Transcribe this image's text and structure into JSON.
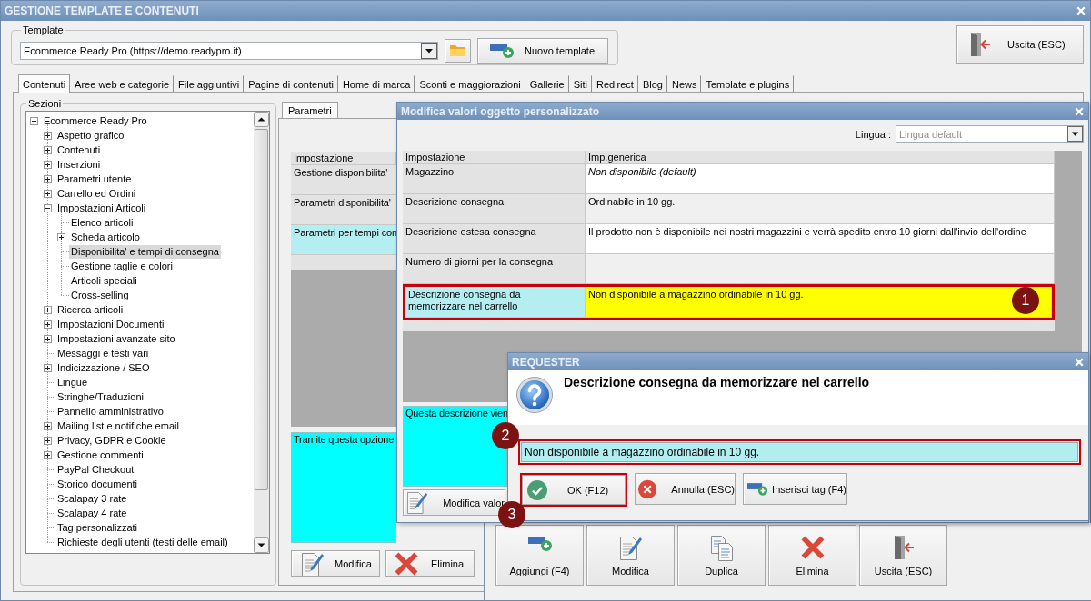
{
  "window": {
    "title": "GESTIONE TEMPLATE E CONTENUTI"
  },
  "template": {
    "legend": "Template",
    "value": "Ecommerce Ready Pro (https://demo.readypro.it)",
    "new_button": "Nuovo template"
  },
  "exit_button": "Uscita (ESC)",
  "tabs": [
    {
      "label": "Contenuti",
      "selected": true
    },
    {
      "label": "Aree web e categorie",
      "selected": false
    },
    {
      "label": "File aggiuntivi",
      "selected": false
    },
    {
      "label": "Pagine di contenuti",
      "selected": false
    },
    {
      "label": "Home di marca",
      "selected": false
    },
    {
      "label": "Sconti e maggiorazioni",
      "selected": false
    },
    {
      "label": "Gallerie",
      "selected": false
    },
    {
      "label": "Siti",
      "selected": false
    },
    {
      "label": "Redirect",
      "selected": false
    },
    {
      "label": "Blog",
      "selected": false
    },
    {
      "label": "News",
      "selected": false
    },
    {
      "label": "Template e plugins",
      "selected": false
    }
  ],
  "sections": {
    "legend": "Sezioni",
    "tree": [
      {
        "label": "Ecommerce Ready Pro",
        "kind": "group",
        "expanded": true,
        "selected": false,
        "children": [
          {
            "label": "Aspetto grafico",
            "kind": "group",
            "expanded": false,
            "selected": false
          },
          {
            "label": "Contenuti",
            "kind": "group",
            "expanded": false,
            "selected": false
          },
          {
            "label": "Inserzioni",
            "kind": "group",
            "expanded": false,
            "selected": false
          },
          {
            "label": "Parametri utente",
            "kind": "group",
            "expanded": false,
            "selected": false
          },
          {
            "label": "Carrello ed Ordini",
            "kind": "group",
            "expanded": false,
            "selected": false
          },
          {
            "label": "Impostazioni Articoli",
            "kind": "group",
            "expanded": true,
            "selected": false,
            "children": [
              {
                "label": "Elenco articoli",
                "kind": "leaf",
                "selected": false
              },
              {
                "label": "Scheda articolo",
                "kind": "group",
                "expanded": false,
                "selected": false
              },
              {
                "label": "Disponibilita' e tempi di consegna",
                "kind": "leaf",
                "selected": true
              },
              {
                "label": "Gestione taglie e colori",
                "kind": "leaf",
                "selected": false
              },
              {
                "label": "Articoli speciali",
                "kind": "leaf",
                "selected": false
              },
              {
                "label": "Cross-selling",
                "kind": "leaf",
                "selected": false
              }
            ]
          },
          {
            "label": "Ricerca articoli",
            "kind": "group",
            "expanded": false,
            "selected": false
          },
          {
            "label": "Impostazioni Documenti",
            "kind": "group",
            "expanded": false,
            "selected": false
          },
          {
            "label": "Impostazioni avanzate sito",
            "kind": "group",
            "expanded": false,
            "selected": false
          },
          {
            "label": "Messaggi e testi vari",
            "kind": "leaf",
            "selected": false
          },
          {
            "label": "Indicizzazione / SEO",
            "kind": "group",
            "expanded": false,
            "selected": false
          },
          {
            "label": "Lingue",
            "kind": "leaf",
            "selected": false
          },
          {
            "label": "Stringhe/Traduzioni",
            "kind": "leaf",
            "selected": false
          },
          {
            "label": "Pannello amministrativo",
            "kind": "leaf",
            "selected": false
          },
          {
            "label": "Mailing list e notifiche email",
            "kind": "group",
            "expanded": false,
            "selected": false
          },
          {
            "label": "Privacy, GDPR e Cookie",
            "kind": "group",
            "expanded": false,
            "selected": false
          },
          {
            "label": "Gestione commenti",
            "kind": "group",
            "expanded": false,
            "selected": false
          },
          {
            "label": "PayPal Checkout",
            "kind": "leaf",
            "selected": false
          },
          {
            "label": "Storico documenti",
            "kind": "leaf",
            "selected": false
          },
          {
            "label": "Scalapay 3 rate",
            "kind": "leaf",
            "selected": false
          },
          {
            "label": "Scalapay 4 rate",
            "kind": "leaf",
            "selected": false
          },
          {
            "label": "Tag personalizzati",
            "kind": "leaf",
            "selected": false
          },
          {
            "label": "Richieste degli utenti (testi delle email)",
            "kind": "leaf",
            "selected": false
          }
        ]
      }
    ]
  },
  "parameters": {
    "tabs": [
      {
        "label": "Parametri",
        "selected": true
      }
    ],
    "columns": [
      "Impostazione"
    ],
    "rows": [
      {
        "setting": "Gestione disponibilita'",
        "selected": false
      },
      {
        "setting": "Parametri disponibilita'",
        "selected": false
      },
      {
        "setting": "Parametri per tempi con",
        "selected": true
      }
    ],
    "description": "Tramite questa opzione",
    "buttons": [
      {
        "kind": "edit",
        "label": "Modifica"
      },
      {
        "kind": "delete",
        "label": "Elimina"
      }
    ]
  },
  "edit_dialog": {
    "title": "Modifica valori oggetto personalizzato",
    "language": {
      "label": "Lingua :",
      "value": "Lingua default",
      "disabled": true
    },
    "columns": [
      "Impostazione",
      "Imp.generica"
    ],
    "rows": [
      {
        "setting": "Magazzino",
        "value": "Non disponibile (default)",
        "is_default": true,
        "selected": false
      },
      {
        "setting": "Descrizione consegna",
        "value": "Ordinabile in 10 gg.",
        "is_default": false,
        "selected": false
      },
      {
        "setting": "Descrizione estesa consegna",
        "value": "Il prodotto non è disponibile nei nostri magazzini e verrà spedito entro 10 giorni dall'invio dell'ordine",
        "is_default": false,
        "selected": false
      },
      {
        "setting": "Numero di giorni per la consegna",
        "selected": false
      },
      {
        "setting": "Descrizione consegna da memorizzare nel carrello",
        "value": "Non disponibile a magazzino ordinabile in 10 gg.",
        "is_default": false,
        "selected": true,
        "annotation": "1"
      }
    ],
    "description": "Questa descrizione vien",
    "edit_button": "Modifica valor"
  },
  "list_window": {
    "buttons": [
      {
        "kind": "add",
        "label": "Aggiungi (F4)"
      },
      {
        "kind": "edit",
        "label": "Modifica"
      },
      {
        "kind": "duplicate",
        "label": "Duplica"
      },
      {
        "kind": "delete",
        "label": "Elimina"
      },
      {
        "kind": "exit",
        "label": "Uscita (ESC)"
      }
    ]
  },
  "requester": {
    "title": "REQUESTER",
    "question": "Descrizione consegna da memorizzare nel carrello",
    "value": "Non disponibile a magazzino ordinabile in 10 gg.",
    "annotation": "2",
    "buttons": [
      {
        "kind": "ok",
        "label": "OK (F12)",
        "annotation": "3"
      },
      {
        "kind": "cancel",
        "label": "Annulla (ESC)"
      },
      {
        "kind": "tag",
        "label": "Inserisci tag (F4)"
      }
    ]
  }
}
